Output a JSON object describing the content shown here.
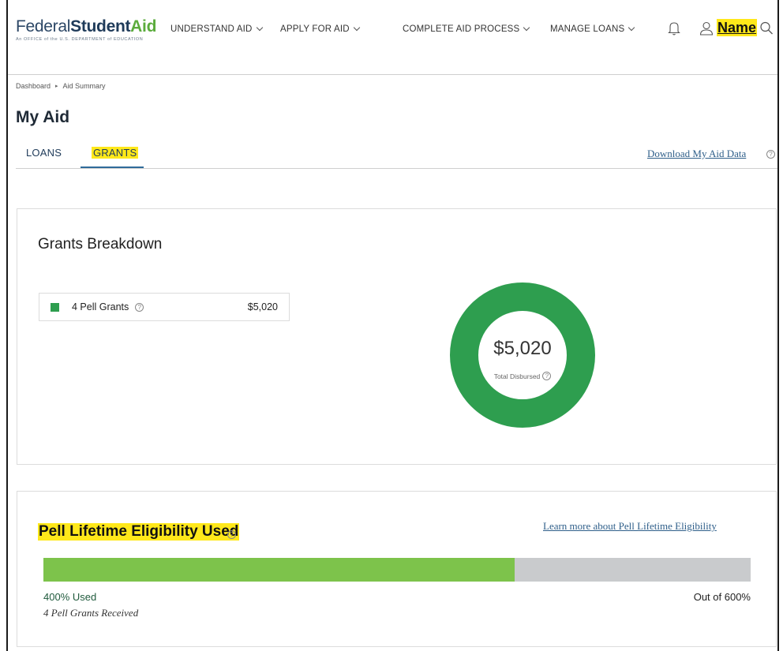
{
  "header": {
    "logo": {
      "word1": "Federal",
      "word2": "Student",
      "word3": "Aid",
      "subtitle": "An OFFICE of the U.S. DEPARTMENT of EDUCATION"
    },
    "nav": [
      {
        "label": "UNDERSTAND AID"
      },
      {
        "label": "APPLY FOR AID"
      },
      {
        "label": "COMPLETE AID PROCESS"
      },
      {
        "label": "MANAGE LOANS"
      }
    ],
    "icons": [
      "bell-icon",
      "user-icon",
      "search-icon"
    ],
    "user_name": "Name"
  },
  "breadcrumb": [
    "Dashboard",
    "Aid Summary"
  ],
  "page_title": "My Aid",
  "tabs": [
    {
      "label": "LOANS",
      "active": false
    },
    {
      "label": "GRANTS",
      "active": true
    }
  ],
  "download_link": "Download My Aid Data",
  "grants_breakdown": {
    "title": "Grants Breakdown",
    "items": [
      {
        "label": "4 Pell Grants",
        "value": "$5,020",
        "color": "#2e9e4f"
      }
    ],
    "total": "$5,020",
    "total_label": "Total Disbursed"
  },
  "pell_eligibility": {
    "title": "Pell Lifetime Eligibility Used",
    "learn_more": "Learn more about Pell Lifetime Eligibility",
    "used_percent": 400,
    "max_percent": 600,
    "used_label": "400% Used",
    "received_label": "4 Pell Grants Received",
    "out_of_label": "Out of 600%"
  },
  "colors": {
    "brand_navy": "#1f3b5a",
    "brand_green": "#5bab3c",
    "donut_green": "#2e9e4f",
    "bar_fill": "#7dc34b",
    "bar_track": "#c9cbcd",
    "highlight": "#ffe81a",
    "link": "#2f5f8a"
  }
}
